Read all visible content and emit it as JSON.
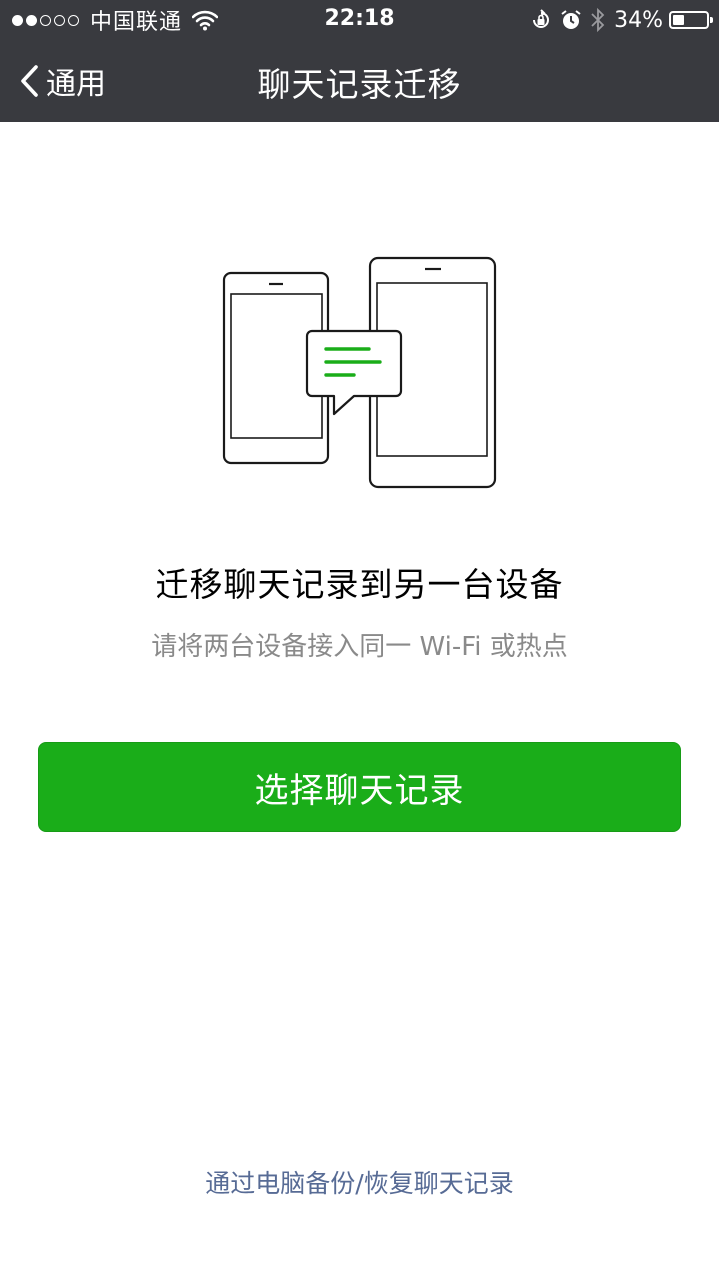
{
  "status_bar": {
    "carrier": "中国联通",
    "signal_bars_filled": 2,
    "signal_bars_total": 5,
    "time": "22:18",
    "battery_percent": "34%",
    "battery_level": 0.34,
    "icons": [
      "wifi-icon",
      "orientation-lock-icon",
      "alarm-icon",
      "bluetooth-icon",
      "battery-icon"
    ]
  },
  "nav": {
    "back_label": "通用",
    "title": "聊天记录迁移"
  },
  "main": {
    "illustration": "phones-transfer-illustration",
    "headline": "迁移聊天记录到另一台设备",
    "subtitle": "请将两台设备接入同一 Wi-Fi 或热点",
    "primary_button": "选择聊天记录",
    "footer_link": "通过电脑备份/恢复聊天记录"
  },
  "colors": {
    "nav_background": "#393a3f",
    "accent_green": "#1aad19",
    "link_blue": "#576b95",
    "subtitle_gray": "#8a8a8a"
  }
}
